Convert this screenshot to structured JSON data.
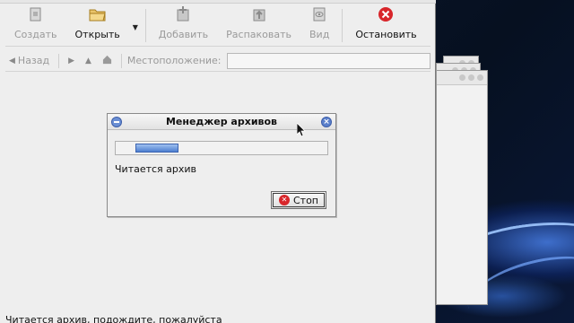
{
  "toolbar": {
    "create_label": "Создать",
    "open_label": "Открыть",
    "add_label": "Добавить",
    "extract_label": "Распаковать",
    "view_label": "Вид",
    "stop_label": "Остановить"
  },
  "location_bar": {
    "back_label": "Назад",
    "location_label": "Местоположение:",
    "location_value": ""
  },
  "dialog": {
    "title": "Менеджер архивов",
    "message": "Читается архив",
    "stop_label": "Стоп",
    "progress": 0.2
  },
  "status": {
    "text": "Читается архив, подождите, пожалуйста"
  },
  "colors": {
    "accent": "#4d7fd0",
    "stop_red": "#d8262b",
    "desktop": "#0a1224"
  }
}
